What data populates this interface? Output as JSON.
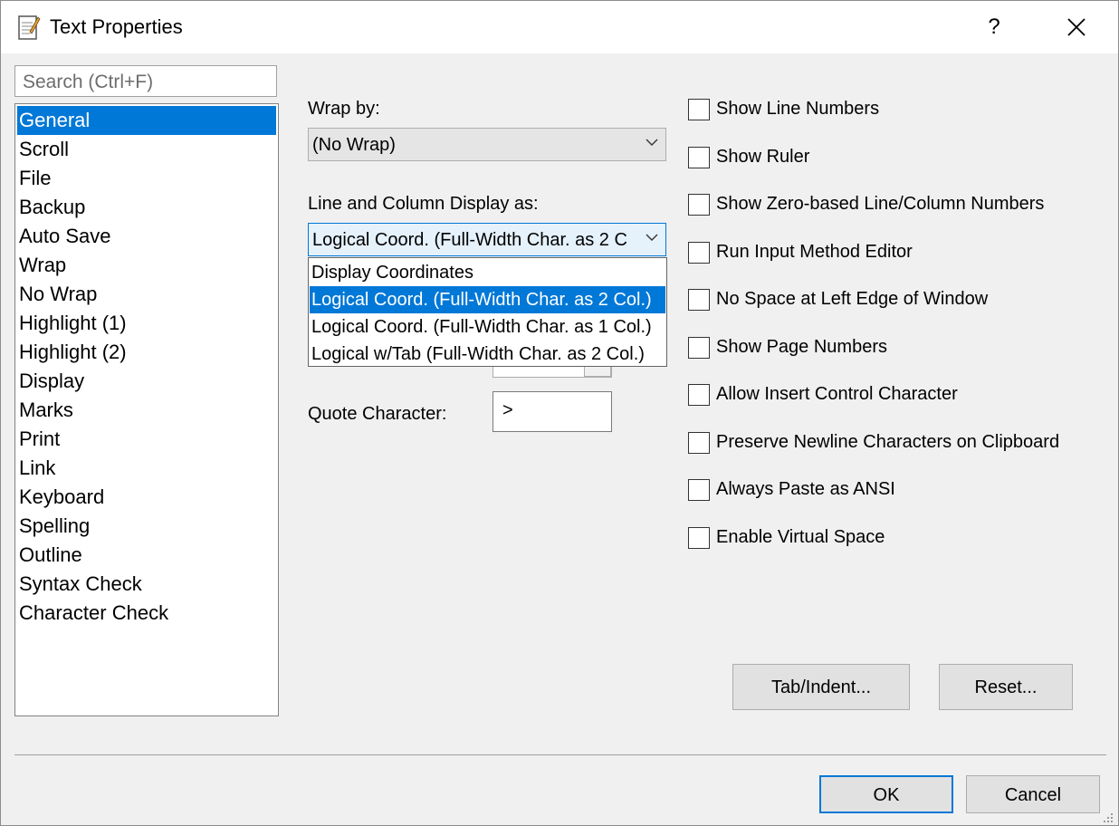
{
  "window": {
    "title": "Text Properties",
    "help_label": "?",
    "close_label": "✕",
    "icon": "notepad-icon"
  },
  "search": {
    "placeholder": "Search (Ctrl+F)"
  },
  "nav": {
    "items": [
      "General",
      "Scroll",
      "File",
      "Backup",
      "Auto Save",
      "Wrap",
      "No Wrap",
      "Highlight (1)",
      "Highlight (2)",
      "Display",
      "Marks",
      "Print",
      "Link",
      "Keyboard",
      "Spelling",
      "Outline",
      "Syntax Check",
      "Character Check"
    ],
    "selected": "General"
  },
  "wrap": {
    "label": "Wrap by:",
    "value": "(No Wrap)"
  },
  "linecol": {
    "label": "Line and Column Display as:",
    "value": "Logical Coord. (Full-Width Char. as 2 C",
    "options": [
      "Display Coordinates",
      "Logical Coord. (Full-Width Char. as 2 Col.)",
      "Logical Coord. (Full-Width Char. as 1 Col.)",
      "Logical w/Tab (Full-Width Char. as 2 Col.)"
    ],
    "selected_index": 1
  },
  "quote": {
    "label": "Quote Character:",
    "value": ">"
  },
  "checkboxes": [
    {
      "label": "Show Line Numbers",
      "checked": false
    },
    {
      "label": "Show Ruler",
      "checked": false
    },
    {
      "label": "Show Zero-based Line/Column Numbers",
      "checked": false
    },
    {
      "label": "Run Input Method Editor",
      "checked": false
    },
    {
      "label": "No Space at Left Edge of Window",
      "checked": false
    },
    {
      "label": "Show Page Numbers",
      "checked": false
    },
    {
      "label": "Allow Insert Control Character",
      "checked": false
    },
    {
      "label": "Preserve Newline Characters on Clipboard",
      "checked": false
    },
    {
      "label": "Always Paste as ANSI",
      "checked": false
    },
    {
      "label": "Enable Virtual Space",
      "checked": false
    }
  ],
  "buttons": {
    "tab_indent": "Tab/Indent...",
    "reset": "Reset...",
    "ok": "OK",
    "cancel": "Cancel"
  },
  "colors": {
    "accent": "#0078d7",
    "dialog_bg": "#f0f0f0",
    "button_bg": "#e1e1e1"
  }
}
